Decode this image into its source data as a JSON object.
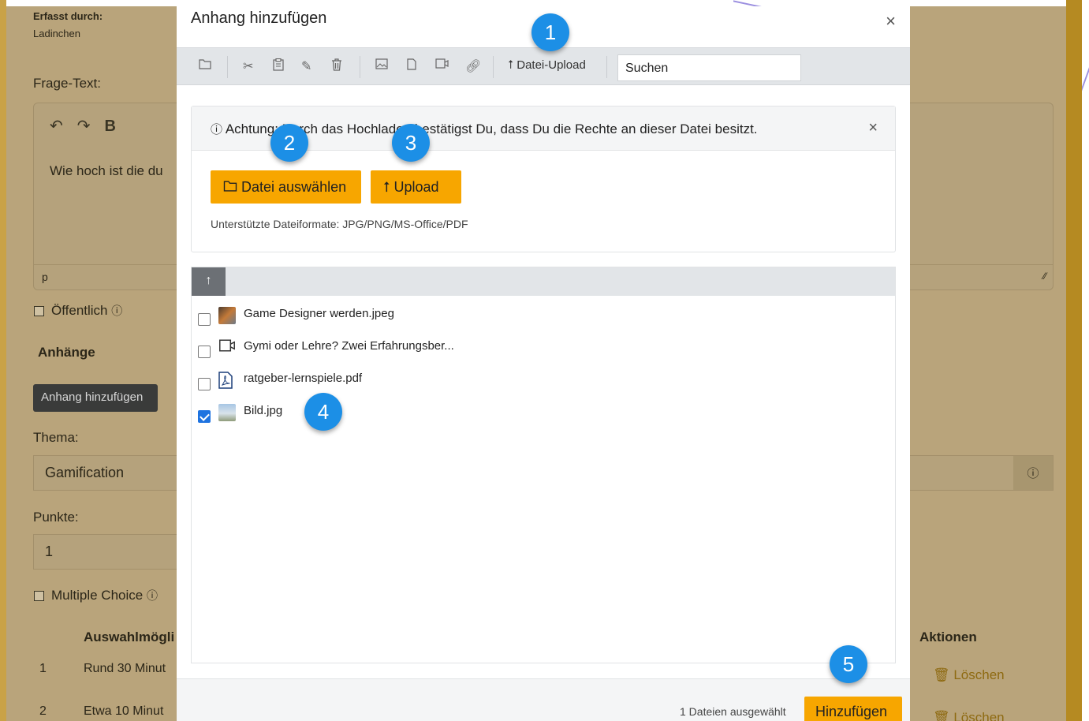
{
  "background": {
    "captured_by_label": "Erfasst durch:",
    "captured_by_value": "Ladinchen",
    "question_text_label": "Frage-Text:",
    "editor_bold": "B",
    "editor_text": "Wie hoch ist die du",
    "editor_status": "p",
    "public_label": "Öffentlich",
    "attachments_heading": "Anhänge",
    "add_attachment_button": "Anhang hinzufügen",
    "topic_label": "Thema:",
    "topic_value": "Gamification",
    "points_label": "Punkte:",
    "points_value": "1",
    "multiple_choice_label": "Multiple Choice",
    "table": {
      "col_choices": "Auswahlmögli",
      "col_actions": "Aktionen",
      "rows": [
        {
          "num": "1",
          "text": "Rund 30 Minut",
          "action": "Löschen"
        },
        {
          "num": "2",
          "text": "Etwa 10 Minut",
          "action": "Löschen"
        }
      ]
    }
  },
  "modal": {
    "title": "Anhang hinzufügen",
    "close": "×",
    "toolbar": {
      "upload_label": "Datei-Upload",
      "search_value": "Suchen",
      "icons": [
        "folder-icon",
        "cut-icon",
        "clipboard-icon",
        "pencil-icon",
        "trash-icon",
        "image-icon",
        "document-icon",
        "video-icon",
        "link-icon"
      ]
    },
    "upload_panel": {
      "notice": "Achtung: Durch das Hochladen bestätigst Du, dass Du die Rechte an dieser Datei besitzt.",
      "close": "×",
      "choose_file_button": "Datei auswählen",
      "upload_button": "Upload",
      "supported_formats": "Unterstützte Dateiformate: JPG/PNG/MS-Office/PDF"
    },
    "files": [
      {
        "name": "Game Designer werden.jpeg",
        "checked": false,
        "icon": "image-thumbnail"
      },
      {
        "name": "Gymi oder Lehre? Zwei Erfahrungsber...",
        "checked": false,
        "icon": "video-icon"
      },
      {
        "name": "ratgeber-lernspiele.pdf",
        "checked": false,
        "icon": "pdf-icon"
      },
      {
        "name": "Bild.jpg",
        "checked": true,
        "icon": "image-thumbnail"
      }
    ],
    "footer": {
      "selected_count": "1 Dateien ausgewählt",
      "add_button": "Hinzufügen"
    }
  },
  "callouts": [
    "1",
    "2",
    "3",
    "4",
    "5"
  ],
  "colors": {
    "accent": "#f7a600",
    "callout": "#1c8fe6",
    "checkbox_checked": "#1e73e0"
  }
}
